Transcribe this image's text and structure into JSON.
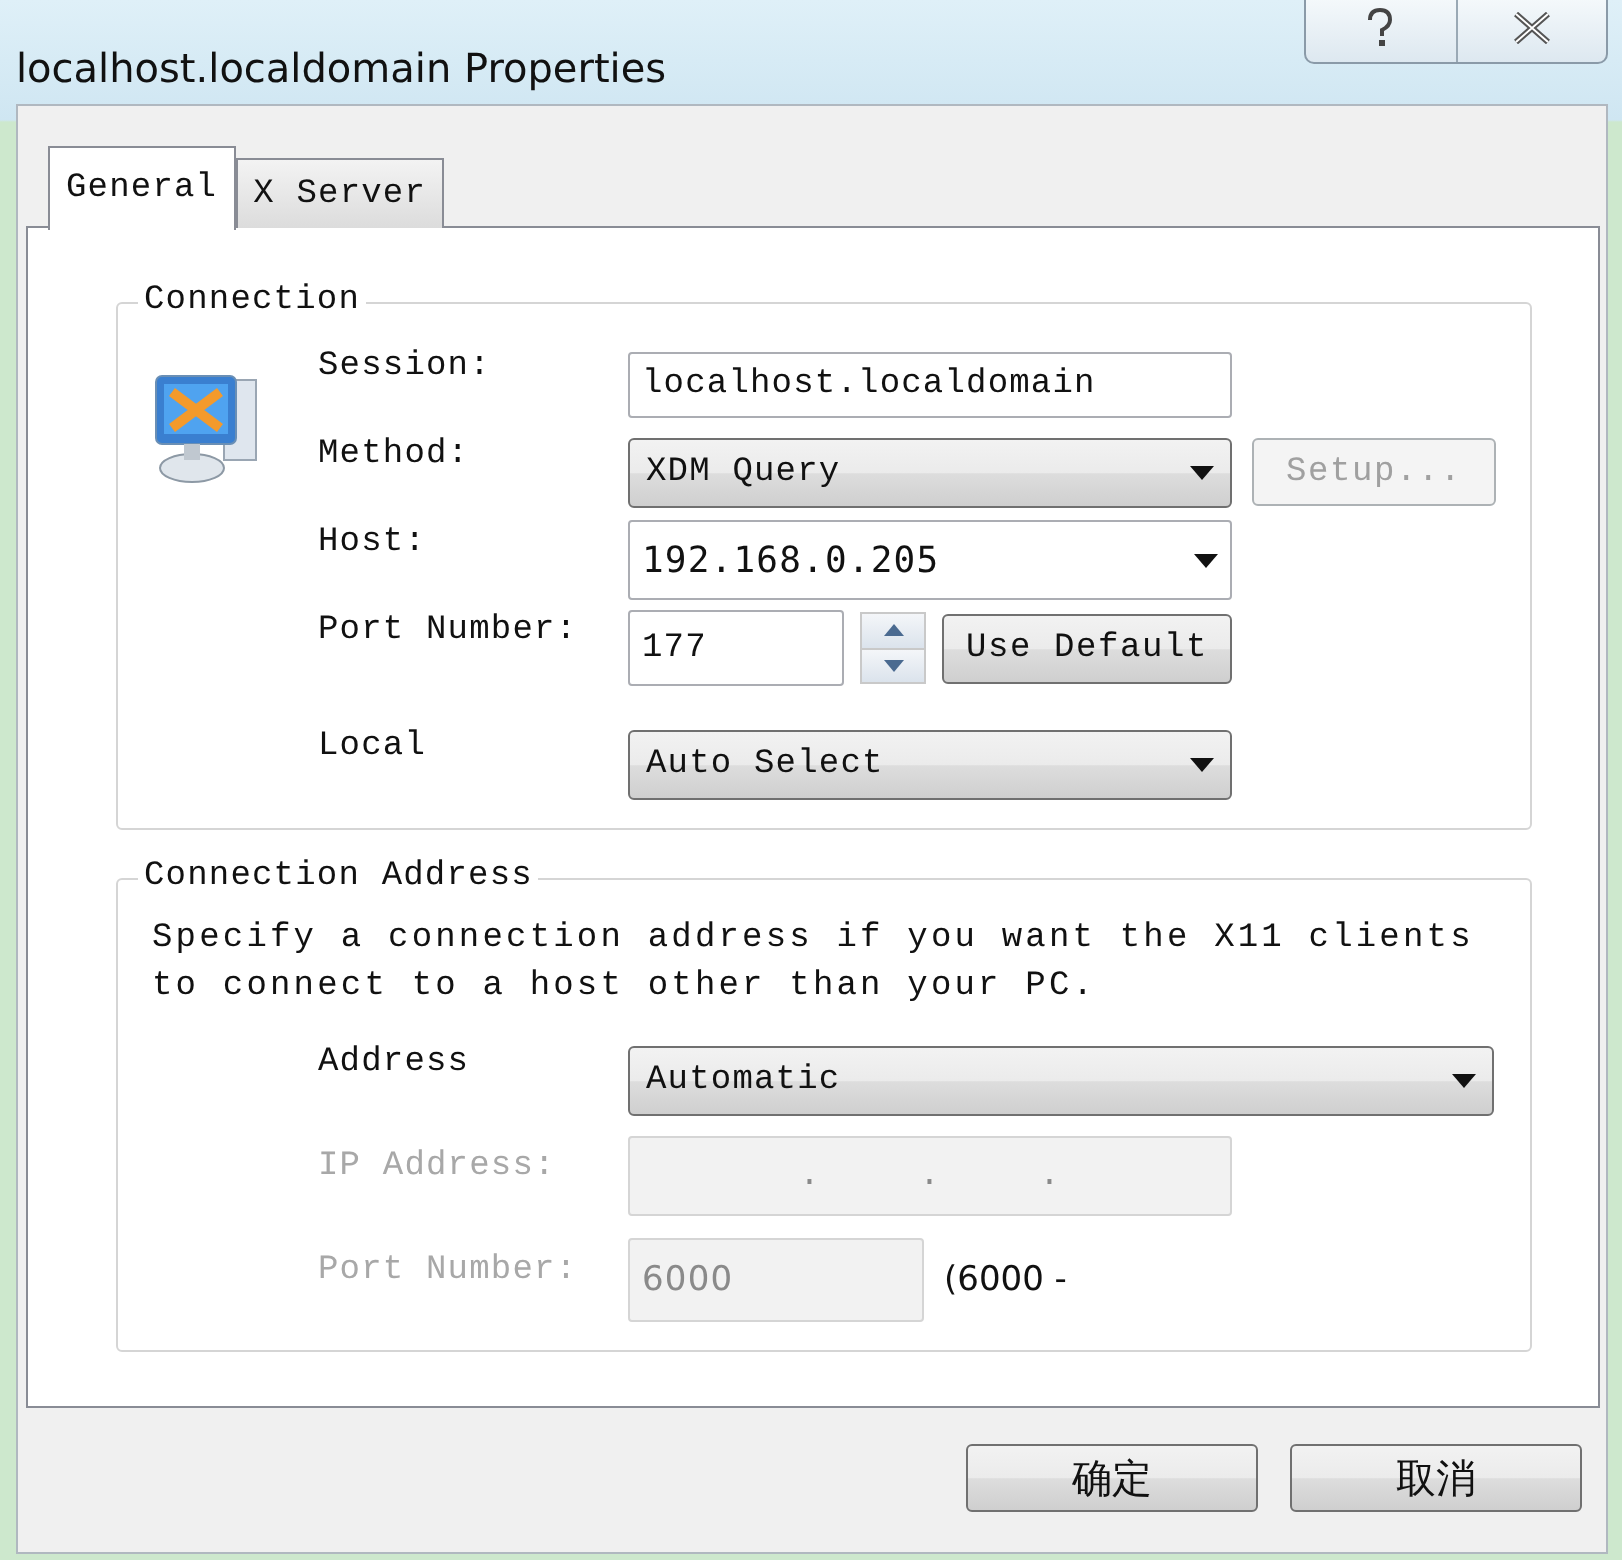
{
  "window": {
    "title": "localhost.localdomain Properties"
  },
  "tabs": [
    {
      "label": "General",
      "selected": true
    },
    {
      "label": "X Server",
      "selected": false
    }
  ],
  "connection": {
    "title": "Connection",
    "rows": [
      {
        "kind": "text",
        "label": "Session:",
        "value": "localhost.localdomain",
        "disabled": false
      },
      {
        "kind": "dropdown",
        "label": "Method:",
        "value": "XDM Query",
        "disabled": false,
        "button": {
          "label": "Setup...",
          "disabled": true
        }
      },
      {
        "kind": "combo",
        "label": "Host:",
        "value": "192.168.0.205",
        "disabled": false
      },
      {
        "kind": "spin",
        "label": "Port Number:",
        "value": "177",
        "disabled": false,
        "button": {
          "label": "Use Default",
          "disabled": false
        }
      },
      {
        "kind": "dropdown",
        "label": "Local",
        "value": "Auto Select",
        "disabled": false
      }
    ]
  },
  "connection_address": {
    "title": "Connection Address",
    "description": "Specify a connection address if you want the X11 clients to connect to a host other than your PC.",
    "rows": [
      {
        "kind": "wide_dropdown",
        "label": "Address",
        "value": "Automatic",
        "disabled": false
      },
      {
        "kind": "ip",
        "label": "IP Address:",
        "separator": ".",
        "disabled": true
      },
      {
        "kind": "text",
        "label": "Port Number:",
        "value": "6000",
        "note": "(6000 -",
        "disabled": true
      }
    ]
  },
  "buttons": [
    "确定",
    "取消"
  ]
}
